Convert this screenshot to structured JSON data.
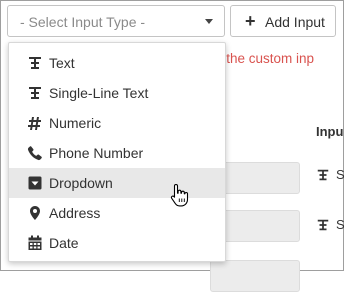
{
  "select": {
    "placeholder": "- Select Input Type -"
  },
  "add_button": {
    "label": "Add Input"
  },
  "hint": {
    "visible_text": "n to the custom inp"
  },
  "table": {
    "column_header_partial": "Inpu",
    "rows": [
      {
        "type_letter": "S"
      },
      {
        "type_letter": "S"
      }
    ]
  },
  "menu": {
    "items": [
      {
        "label": "Text",
        "icon": "text-format-icon"
      },
      {
        "label": "Single-Line Text",
        "icon": "text-format-icon"
      },
      {
        "label": "Numeric",
        "icon": "hash-icon"
      },
      {
        "label": "Phone Number",
        "icon": "phone-icon"
      },
      {
        "label": "Dropdown",
        "icon": "dropdown-box-icon",
        "hovered": true
      },
      {
        "label": "Address",
        "icon": "map-pin-icon"
      },
      {
        "label": "Date",
        "icon": "calendar-icon"
      }
    ]
  },
  "colors": {
    "hint_red": "#d9534f",
    "hover_bg": "#e8e8e8"
  }
}
